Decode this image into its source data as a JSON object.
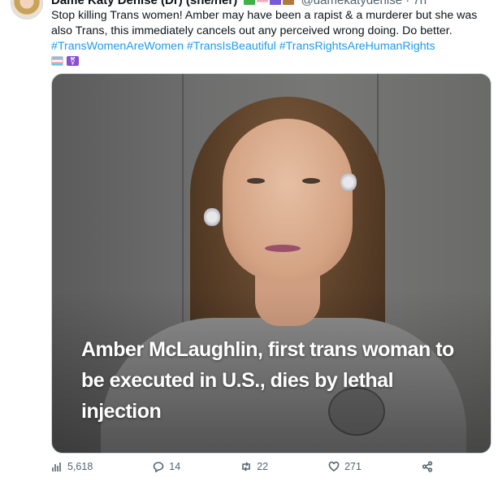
{
  "tweet": {
    "author_name": "Dame Katy Denise (Dr) (she/her)",
    "author_handle": "@damekatydenise · 7h",
    "text_before": "Stop killing Trans women! Amber may have been a rapist & a murderer but she was also Trans, this immediately cancels out any perceived wrong doing. Do better. ",
    "hashtags": [
      "#TransWomenAreWomen",
      "#TransIsBeautiful",
      "#TransRightsAreHumanRights"
    ],
    "emoji_symbol": "⚧"
  },
  "media": {
    "headline": "Amber McLaughlin, first trans woman to be executed in U.S., dies by lethal injection"
  },
  "actions": {
    "views": "5,618",
    "replies": "14",
    "retweets": "22",
    "likes": "271"
  },
  "colors": {
    "accent": "#1d9bf0",
    "muted": "#536471"
  }
}
